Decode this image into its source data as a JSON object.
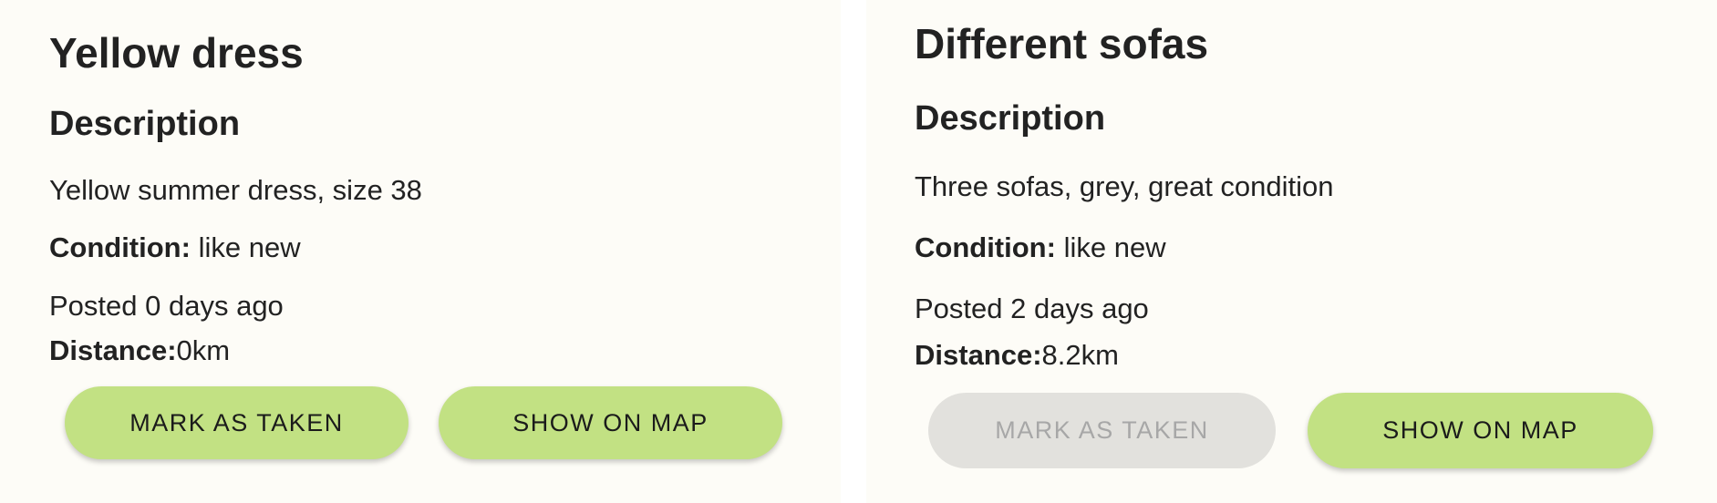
{
  "cards": [
    {
      "title": "Yellow dress",
      "description_heading": "Description",
      "description": "Yellow summer dress, size 38",
      "condition_label": "Condition:",
      "condition_value": "like new",
      "posted": "Posted 0 days ago",
      "distance_label": "Distance:",
      "distance_value": "0km",
      "mark_taken_label": "MARK AS TAKEN",
      "mark_taken_enabled": true,
      "show_map_label": "SHOW ON MAP"
    },
    {
      "title": "Different sofas",
      "description_heading": "Description",
      "description": "Three sofas, grey, great condition",
      "condition_label": "Condition:",
      "condition_value": "like new",
      "posted": "Posted 2 days ago",
      "distance_label": "Distance:",
      "distance_value": "8.2km",
      "mark_taken_label": "MARK AS TAKEN",
      "mark_taken_enabled": false,
      "show_map_label": "SHOW ON MAP"
    }
  ],
  "colors": {
    "card_background": "#fdfcf7",
    "button_green": "#c2e183",
    "button_disabled": "#e2e1dd",
    "disabled_text": "#a7a7a7",
    "text": "#222222"
  }
}
